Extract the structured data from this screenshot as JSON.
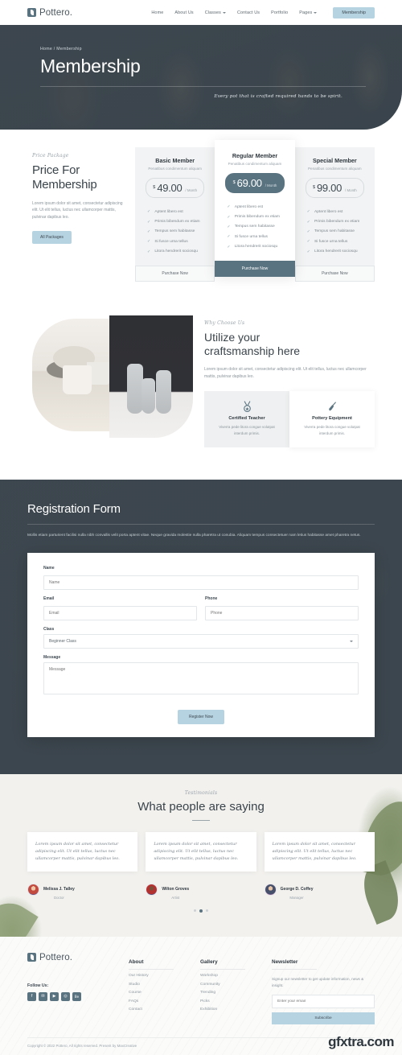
{
  "header": {
    "logo_text": "Pottero.",
    "nav": [
      {
        "label": "Home",
        "caret": false
      },
      {
        "label": "About Us",
        "caret": false
      },
      {
        "label": "Classes",
        "caret": true
      },
      {
        "label": "Contact Us",
        "caret": false
      },
      {
        "label": "Portfolio",
        "caret": false
      },
      {
        "label": "Pages",
        "caret": true
      }
    ],
    "cta_label": "Membership"
  },
  "hero": {
    "breadcrumb": "Home / Membership",
    "title": "Membership",
    "script_tagline": "Every pot that is crafted required hands to be spirit."
  },
  "pricing": {
    "eyebrow": "Price Package",
    "title": "Price For Membership",
    "body": "Lorem ipsum dolor sit amet, consectetur adipiscing elit. Ut elit tellus, luctus nec ullamcorper mattis, pulvinar dapibus leo.",
    "button_label": "All Packages",
    "cards": [
      {
        "name": "Basic Member",
        "subtitle": "Penatibus condimentum aliquam",
        "currency": "$",
        "amount": "49.00",
        "period": "/ Month",
        "features": [
          "Aptent libero est",
          "Primis bibendum ex etiam",
          "Tempus sem habitasse",
          "Si fusce urna tellus",
          "Litora hendrerit sociosqu"
        ],
        "buy_label": "Purchase Now",
        "featured": false
      },
      {
        "name": "Regular Member",
        "subtitle": "Penatibus condimentum aliquam",
        "currency": "$",
        "amount": "69.00",
        "period": "/ Month",
        "features": [
          "Aptent libero est",
          "Primis bibendum ex etiam",
          "Tempus sem habitasse",
          "Si fusce urna tellus",
          "Litora hendrerit sociosqu"
        ],
        "buy_label": "Purchase Now",
        "featured": true
      },
      {
        "name": "Special Member",
        "subtitle": "Penatibus condimentum aliquam",
        "currency": "$",
        "amount": "99.00",
        "period": "/ Month",
        "features": [
          "Aptent libero est",
          "Primis bibendum ex etiam",
          "Tempus sem habitasse",
          "Si fusce urna tellus",
          "Litora hendrerit sociosqu"
        ],
        "buy_label": "Purchase Now",
        "featured": false
      }
    ]
  },
  "why": {
    "eyebrow": "Why Choose Us",
    "title_line1": "Utilize your",
    "title_line2": "craftsmanship here",
    "body": "Lorem ipsum dolor sit amet, consectetur adipiscing elit. Ut elit tellus, luctus nec ullamcorper mattis, pulvinar dapibus leo.",
    "boxes": [
      {
        "icon": "medal-icon",
        "title": "Certified Teacher",
        "body": "Viverra pede litora congue volutpat interdum primis."
      },
      {
        "icon": "paint-brush-icon",
        "title": "Pottery Equipment",
        "body": "Viverra pede litora congue volutpat interdum primis."
      }
    ]
  },
  "registration": {
    "title": "Registration Form",
    "body": "Mollis etiam parturient facilisi nulla nibh convallis velit porta aptent vitae. Neque gravida molestie nulla pharetra ut conubia. Aliquam tempus consectetuer nam letius habitasse amet pharetra netus.",
    "fields": {
      "name_label": "Name",
      "name_placeholder": "Name",
      "email_label": "Email",
      "email_placeholder": "Email",
      "phone_label": "Phone",
      "phone_placeholder": "Phone",
      "class_label": "Class",
      "class_value": "Beginner Class",
      "message_label": "Message",
      "message_placeholder": "Message"
    },
    "submit_label": "Register Now"
  },
  "testimonials": {
    "eyebrow": "Testimonials",
    "title": "What people are saying",
    "items": [
      {
        "quote": "Lorem ipsum dolor sit amet, consectetur adipiscing elit. Ut elit tellus, luctus nec ullamcorper mattis, pulvinar dapibus leo.",
        "name": "Melissa J. Talley",
        "role": "Doctor"
      },
      {
        "quote": "Lorem ipsum dolor sit amet, consectetur adipiscing elit. Ut elit tellus, luctus nec ullamcorper mattis, pulvinar dapibus leo.",
        "name": "Wilton Groves",
        "role": "Artist"
      },
      {
        "quote": "Lorem ipsum dolor sit amet, consectetur adipiscing elit. Ut elit tellus, luctus nec ullamcorper mattis, pulvinar dapibus leo.",
        "name": "George D. Coffey",
        "role": "Manager"
      }
    ],
    "active_dot": 1
  },
  "footer": {
    "logo_text": "Pottero.",
    "follow_label": "Follow Us:",
    "socials": [
      {
        "name": "facebook-icon",
        "glyph": "f"
      },
      {
        "name": "twitter-icon",
        "glyph": "✉"
      },
      {
        "name": "youtube-icon",
        "glyph": "▶"
      },
      {
        "name": "instagram-icon",
        "glyph": "◎"
      },
      {
        "name": "behance-icon",
        "glyph": "Be"
      }
    ],
    "about": {
      "heading": "About",
      "links": [
        "Our History",
        "Studio",
        "Course",
        "FAQs",
        "Contact"
      ]
    },
    "gallery": {
      "heading": "Gallery",
      "links": [
        "Workshop",
        "Community",
        "Trending",
        "Picks",
        "Exhibition"
      ]
    },
    "newsletter": {
      "heading": "Newsletter",
      "body": "Signup our newsletter to get update information, news & insight.",
      "placeholder": "Enter your email",
      "button_label": "Subscribe"
    },
    "copyright": "Copyright © 2022 Pottero, All rights reserved. Present by MaxCreative",
    "watermark": "gfxtra.com"
  }
}
